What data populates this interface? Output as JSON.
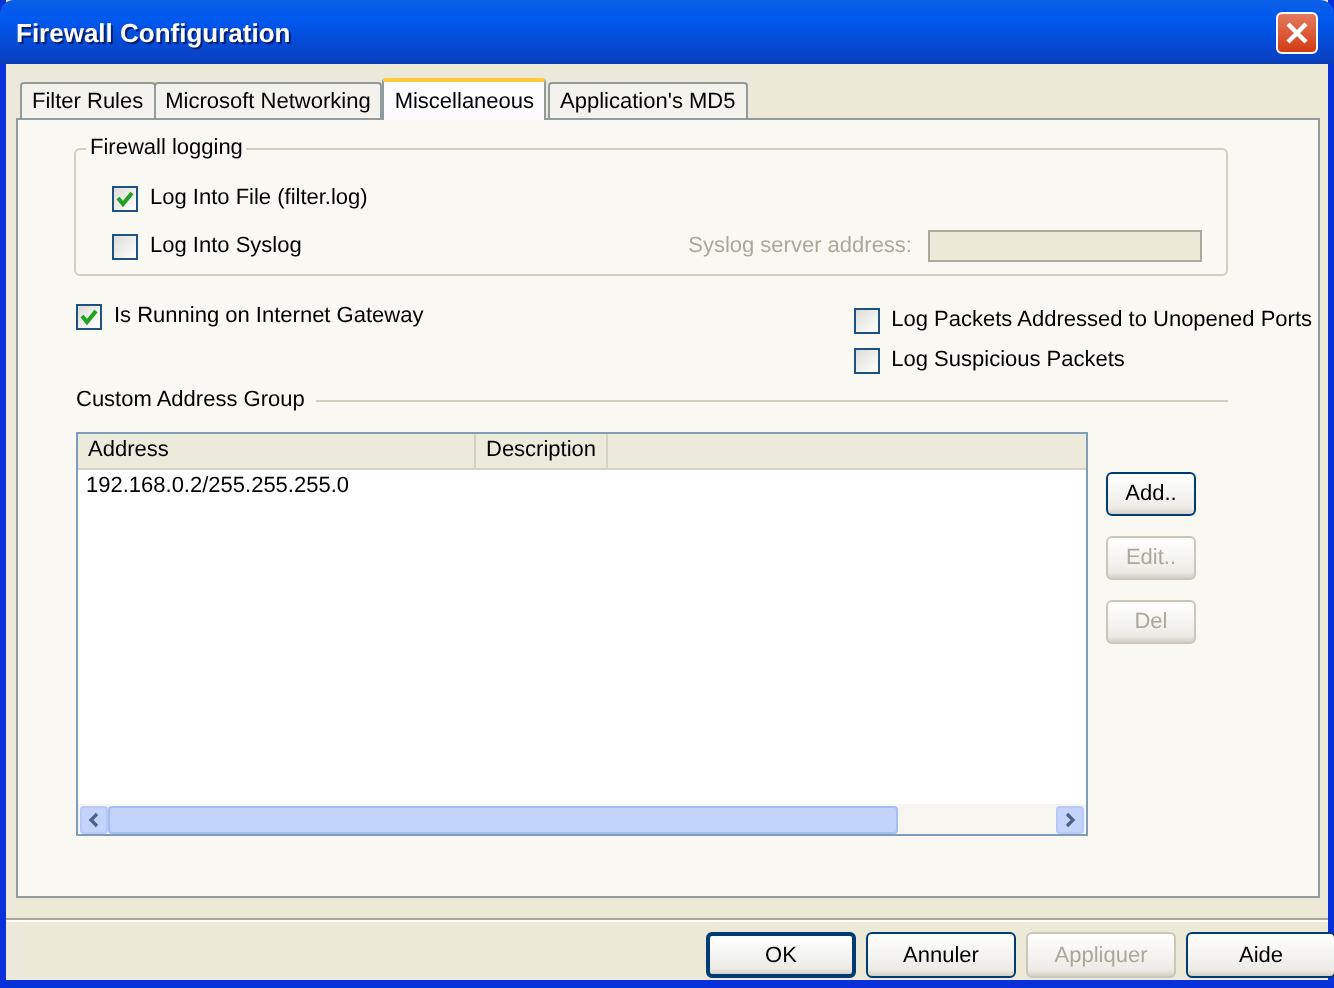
{
  "window": {
    "title": "Firewall Configuration"
  },
  "tabs": [
    {
      "label": "Filter Rules",
      "selected": false
    },
    {
      "label": "Microsoft Networking",
      "selected": false
    },
    {
      "label": "Miscellaneous",
      "selected": true
    },
    {
      "label": "Application's MD5",
      "selected": false
    }
  ],
  "logging": {
    "title": "Firewall logging",
    "options": [
      {
        "label": "Log Into File (filter.log)",
        "checked": true
      },
      {
        "label": "Log Into Syslog",
        "checked": false
      }
    ],
    "syslog_label": "Syslog server address:",
    "syslog_disabled": true
  },
  "left_options": [
    {
      "label": "Is Running on Internet Gateway",
      "checked": true
    }
  ],
  "right_options": [
    {
      "label": "Log Packets Addressed to Unopened Ports",
      "checked": false
    },
    {
      "label": "Log Suspicious Packets",
      "checked": false
    }
  ],
  "address_group": {
    "title": "Custom Address Group",
    "columns": [
      "Address",
      "Description"
    ],
    "rows": [
      [
        "192.168.0.2/255.255.255.0",
        ""
      ]
    ],
    "buttons": [
      {
        "label": "Add..",
        "disabled": false
      },
      {
        "label": "Edit..",
        "disabled": true
      },
      {
        "label": "Del",
        "disabled": true
      }
    ]
  },
  "dialog_buttons": [
    {
      "label": "OK",
      "disabled": false,
      "default": true
    },
    {
      "label": "Annuler",
      "disabled": false,
      "default": false
    },
    {
      "label": "Appliquer",
      "disabled": true,
      "default": false
    },
    {
      "label": "Aide",
      "disabled": false,
      "default": false
    }
  ]
}
